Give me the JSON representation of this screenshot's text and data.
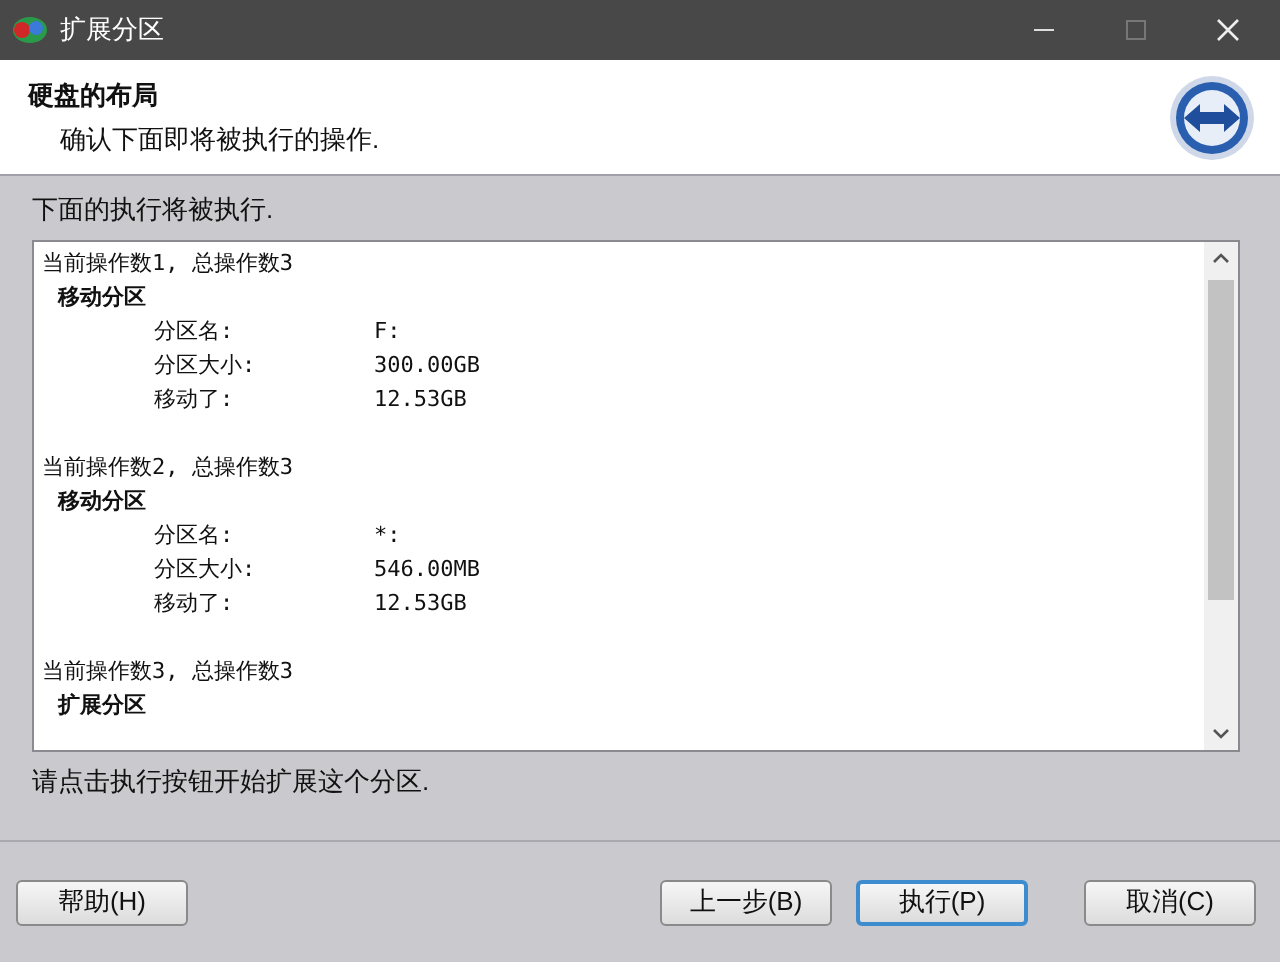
{
  "window": {
    "title": "扩展分区"
  },
  "header": {
    "title": "硬盘的布局",
    "subtitle": "确认下面即将被执行的操作."
  },
  "intro": "下面的执行将被执行.",
  "log": [
    {
      "heading": "当前操作数1, 总操作数3",
      "action": "移动分区",
      "fields": [
        {
          "label": "分区名:",
          "value": "F:"
        },
        {
          "label": "分区大小:",
          "value": "300.00GB"
        },
        {
          "label": "移动了:",
          "value": "12.53GB"
        }
      ]
    },
    {
      "heading": "当前操作数2, 总操作数3",
      "action": "移动分区",
      "fields": [
        {
          "label": "分区名:",
          "value": "*:"
        },
        {
          "label": "分区大小:",
          "value": "546.00MB"
        },
        {
          "label": "移动了:",
          "value": "12.53GB"
        }
      ]
    },
    {
      "heading": "当前操作数3, 总操作数3",
      "action": "扩展分区"
    }
  ],
  "hint": "请点击执行按钮开始扩展这个分区.",
  "buttons": [
    {
      "label": "帮助(H)",
      "default": false
    },
    {
      "label": "上一步(B)",
      "default": false
    },
    {
      "label": "执行(P)",
      "default": true
    },
    {
      "label": "取消(C)",
      "default": false
    }
  ]
}
